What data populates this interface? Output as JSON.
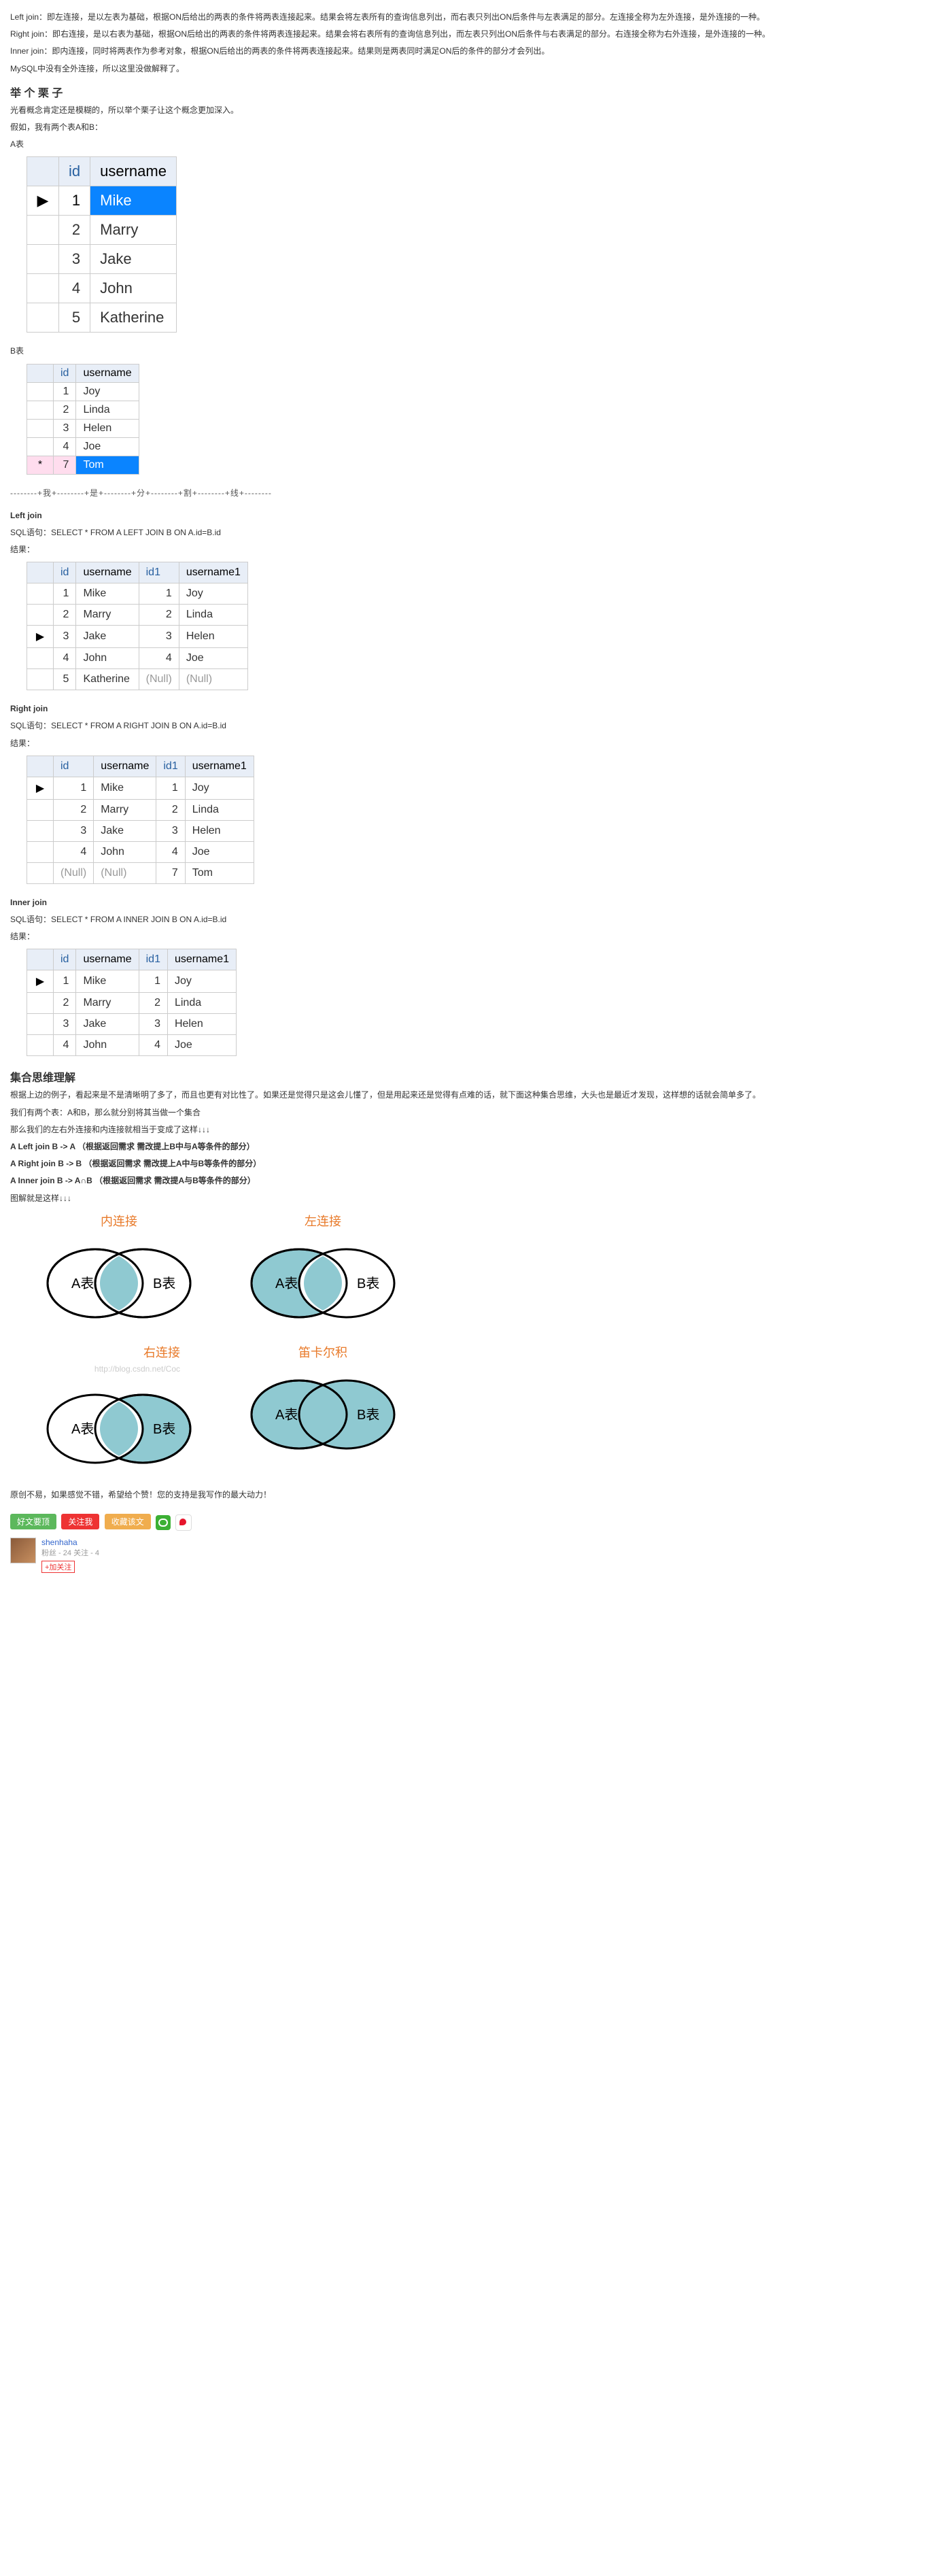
{
  "intro": {
    "left": "Left join：即左连接，是以左表为基础，根据ON后给出的两表的条件将两表连接起来。结果会将左表所有的查询信息列出，而右表只列出ON后条件与左表满足的部分。左连接全称为左外连接，是外连接的一种。",
    "right": "Right join：即右连接，是以右表为基础，根据ON后给出的两表的条件将两表连接起来。结果会将右表所有的查询信息列出，而左表只列出ON后条件与右表满足的部分。右连接全称为右外连接，是外连接的一种。",
    "inner": "Inner join：即内连接，同时将两表作为参考对象，根据ON后给出的两表的条件将两表连接起来。结果则是两表同时满足ON后的条件的部分才会列出。",
    "mysql": "MySQL中没有全外连接，所以这里没做解释了。"
  },
  "example_heading": "举 个 栗 子",
  "example_intro1": "光看概念肯定还是模糊的，所以举个栗子让这个概念更加深入。",
  "example_intro2": "假如，我有两个表A和B：",
  "labelA": "A表",
  "labelB": "B表",
  "tableA": {
    "cols": [
      "id",
      "username"
    ],
    "rows": [
      {
        "id": "1",
        "u": "Mike",
        "sel": true,
        "mark": "▶"
      },
      {
        "id": "2",
        "u": "Marry"
      },
      {
        "id": "3",
        "u": "Jake"
      },
      {
        "id": "4",
        "u": "John"
      },
      {
        "id": "5",
        "u": "Katherine"
      }
    ]
  },
  "tableB": {
    "cols": [
      "id",
      "username"
    ],
    "rows": [
      {
        "id": "1",
        "u": "Joy"
      },
      {
        "id": "2",
        "u": "Linda"
      },
      {
        "id": "3",
        "u": "Helen"
      },
      {
        "id": "4",
        "u": "Joe"
      },
      {
        "id": "7",
        "u": "Tom",
        "sel": true,
        "mark": "*"
      }
    ]
  },
  "divider": "--------+我+--------+是+--------+分+--------+割+--------+线+--------",
  "leftjoin": {
    "title": "Left join",
    "sql": "SQL语句：SELECT * FROM A LEFT JOIN B ON A.id=B.id",
    "res": "结果：",
    "cols": [
      "id",
      "username",
      "id1",
      "username1"
    ],
    "rows": [
      {
        "c": [
          "1",
          "Mike",
          "1",
          "Joy"
        ]
      },
      {
        "c": [
          "2",
          "Marry",
          "2",
          "Linda"
        ]
      },
      {
        "c": [
          "3",
          "Jake",
          "3",
          "Helen"
        ],
        "mark": "▶"
      },
      {
        "c": [
          "4",
          "John",
          "4",
          "Joe"
        ]
      },
      {
        "c": [
          "5",
          "Katherine",
          "(Null)",
          "(Null)"
        ],
        "nulls": [
          2,
          3
        ]
      }
    ]
  },
  "rightjoin": {
    "title": "Right join",
    "sql": "SQL语句：SELECT * FROM A RIGHT JOIN B ON A.id=B.id",
    "res": "结果：",
    "cols": [
      "id",
      "username",
      "id1",
      "username1"
    ],
    "rows": [
      {
        "c": [
          "1",
          "Mike",
          "1",
          "Joy"
        ],
        "mark": "▶"
      },
      {
        "c": [
          "2",
          "Marry",
          "2",
          "Linda"
        ]
      },
      {
        "c": [
          "3",
          "Jake",
          "3",
          "Helen"
        ]
      },
      {
        "c": [
          "4",
          "John",
          "4",
          "Joe"
        ]
      },
      {
        "c": [
          "(Null)",
          "(Null)",
          "7",
          "Tom"
        ],
        "nulls": [
          0,
          1
        ]
      }
    ]
  },
  "innerjoin": {
    "title": "Inner join",
    "sql": "SQL语句：SELECT * FROM A INNER JOIN B ON A.id=B.id",
    "res": "结果：",
    "cols": [
      "id",
      "username",
      "id1",
      "username1"
    ],
    "rows": [
      {
        "c": [
          "1",
          "Mike",
          "1",
          "Joy"
        ],
        "mark": "▶"
      },
      {
        "c": [
          "2",
          "Marry",
          "2",
          "Linda"
        ]
      },
      {
        "c": [
          "3",
          "Jake",
          "3",
          "Helen"
        ]
      },
      {
        "c": [
          "4",
          "John",
          "4",
          "Joe"
        ]
      }
    ]
  },
  "set_heading": "集合思维理解",
  "set_p1": "根据上边的例子，看起来是不是清晰明了多了，而且也更有对比性了。如果还是觉得只是这会儿懂了，但是用起来还是觉得有点难的话，就下面这种集合思维，大头也是最近才发现，这样想的话就会简单多了。",
  "set_p2": "我们有两个表：A和B，那么就分别将其当做一个集合",
  "set_p3": "那么我们的左右外连接和内连接就相当于变成了这样↓↓↓",
  "set_a": "A Left join B -> A  （根据返回需求 需改提上B中与A等条件的部分）",
  "set_b": "A Right join B -> B  （根据返回需求 需改提上A中与B等条件的部分）",
  "set_c": "A Inner join B -> A∩B  （根据返回需求 需改提A与B等条件的部分）",
  "set_p4": "图解就是这样↓↓↓",
  "venn": {
    "inner": "内连接",
    "left": "左连接",
    "right": "右连接",
    "cross": "笛卡尔积",
    "A": "A表",
    "B": "B表",
    "wm": "http://blog.csdn.net/Coc"
  },
  "closing": "原创不易，如果感觉不错，希望给个赞！您的支持是我写作的最大动力！",
  "buttons": {
    "b1": "好文要顶",
    "b2": "关注我",
    "b3": "收藏该文"
  },
  "author": {
    "name": "shenhaha",
    "meta": "粉丝 - 24  关注 - 4",
    "follow": "+加关注"
  }
}
